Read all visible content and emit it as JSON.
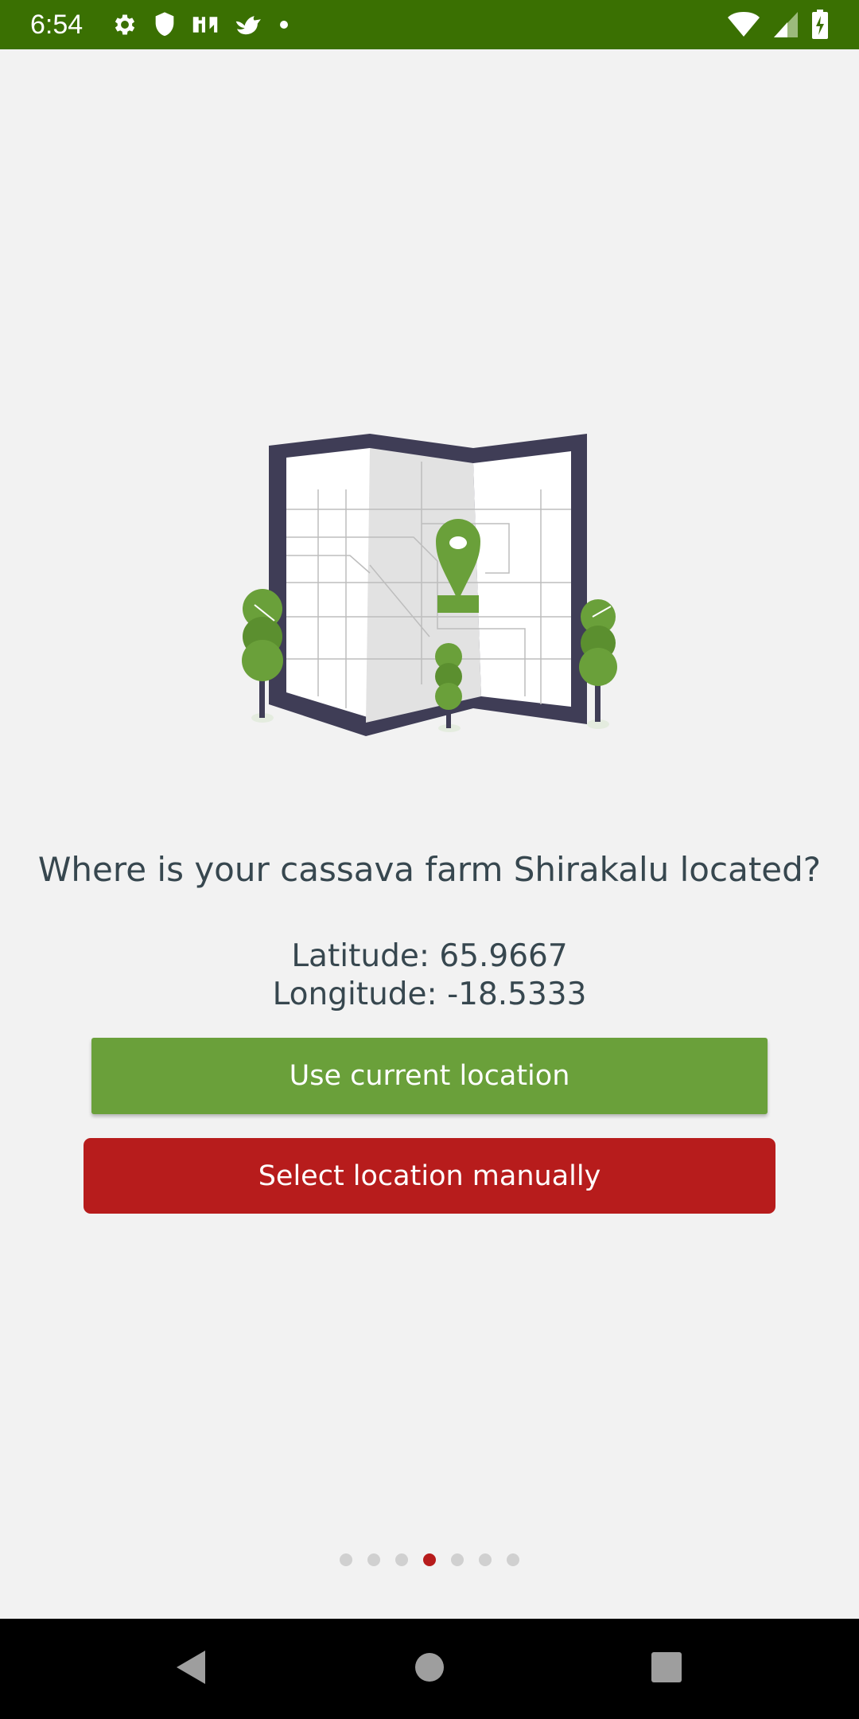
{
  "status_bar": {
    "time": "6:54",
    "left_icons": [
      "gear-icon",
      "shield-icon",
      "app-icon",
      "bird-icon",
      "dot-icon"
    ],
    "right_icons": [
      "wifi-icon",
      "signal-icon",
      "battery-charging-icon"
    ],
    "color": "#3a7002"
  },
  "illustration": {
    "icon": "map-pin-illustration",
    "accent": "#6aa03a"
  },
  "main": {
    "question": "Where is your cassava farm Shirakalu located?",
    "latitude": "Latitude: 65.9667",
    "longitude": "Longitude: -18.5333",
    "use_current_label": "Use current location",
    "select_manual_label": "Select location manually",
    "colors": {
      "primary_green": "#6aa03a",
      "danger_red": "#b71c1c",
      "text": "#37474f"
    }
  },
  "pager": {
    "total": 7,
    "current": 4
  },
  "nav_bar": {
    "icons": [
      "back-icon",
      "home-icon",
      "recents-icon"
    ]
  }
}
